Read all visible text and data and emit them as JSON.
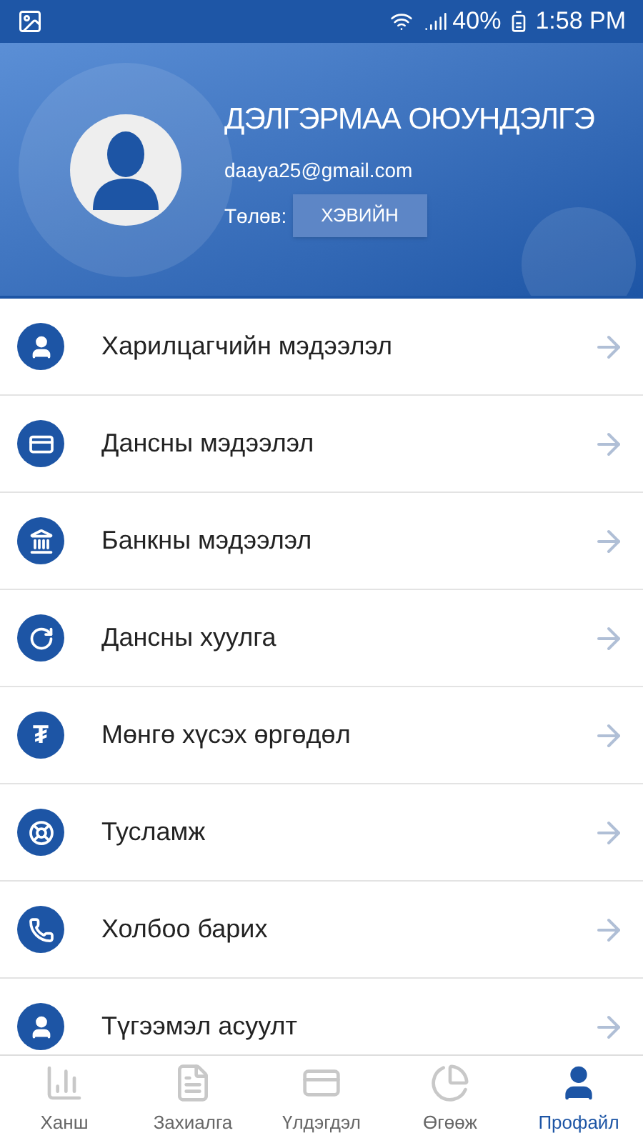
{
  "status_bar": {
    "battery": "40%",
    "time": "1:58 PM"
  },
  "profile": {
    "name": "ДЭЛГЭРМАА ОЮУНДЭЛГЭ",
    "email": "daaya25@gmail.com",
    "status_label": "Төлөв:",
    "status_value": "ХЭВИЙН"
  },
  "menu": [
    {
      "label": "Харилцагчийн мэдээлэл"
    },
    {
      "label": "Дансны мэдээлэл"
    },
    {
      "label": "Банкны мэдээлэл"
    },
    {
      "label": "Дансны хуулга"
    },
    {
      "label": "Мөнгө хүсэх өргөдөл",
      "glyph": "₮"
    },
    {
      "label": "Тусламж"
    },
    {
      "label": "Холбоо барих"
    },
    {
      "label": "Түгээмэл асуулт"
    }
  ],
  "bottom_nav": [
    {
      "label": "Ханш",
      "selected": false
    },
    {
      "label": "Захиалга",
      "selected": false
    },
    {
      "label": "Үлдэгдэл",
      "selected": false
    },
    {
      "label": "Өгөөж",
      "selected": false
    },
    {
      "label": "Профайл",
      "selected": true
    }
  ]
}
